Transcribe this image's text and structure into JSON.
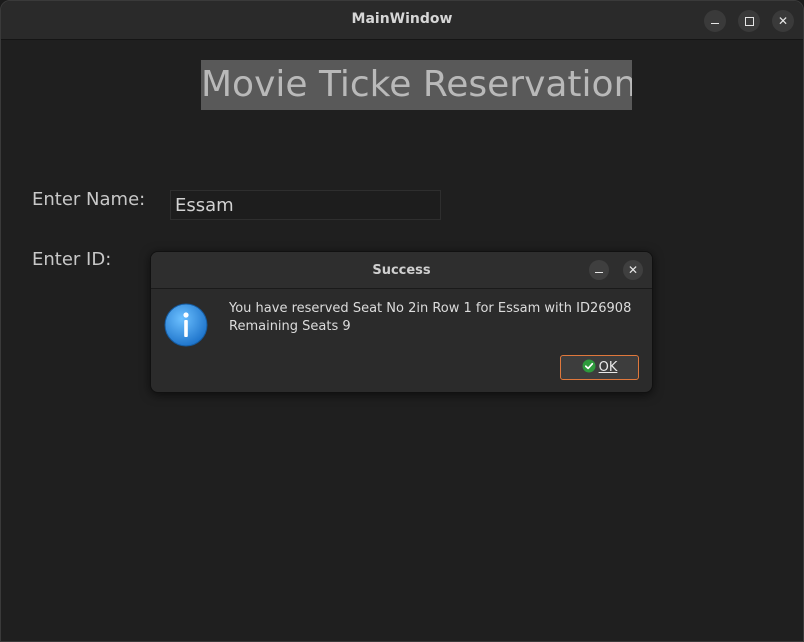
{
  "window": {
    "title": "MainWindow"
  },
  "main": {
    "heading": "Movie Ticke Reservation",
    "name_label": "Enter Name:",
    "name_value": "Essam",
    "id_label": "Enter ID:"
  },
  "dialog": {
    "title": "Success",
    "message_line1": "You have reserved Seat No 2in Row 1 for Essam with ID26908",
    "message_line2": "Remaining Seats 9",
    "ok_label": "OK",
    "icon": "info-icon"
  },
  "colors": {
    "accent_border": "#e0783c",
    "info_blue": "#2a8be0",
    "ok_check_green": "#2e9a3c"
  }
}
